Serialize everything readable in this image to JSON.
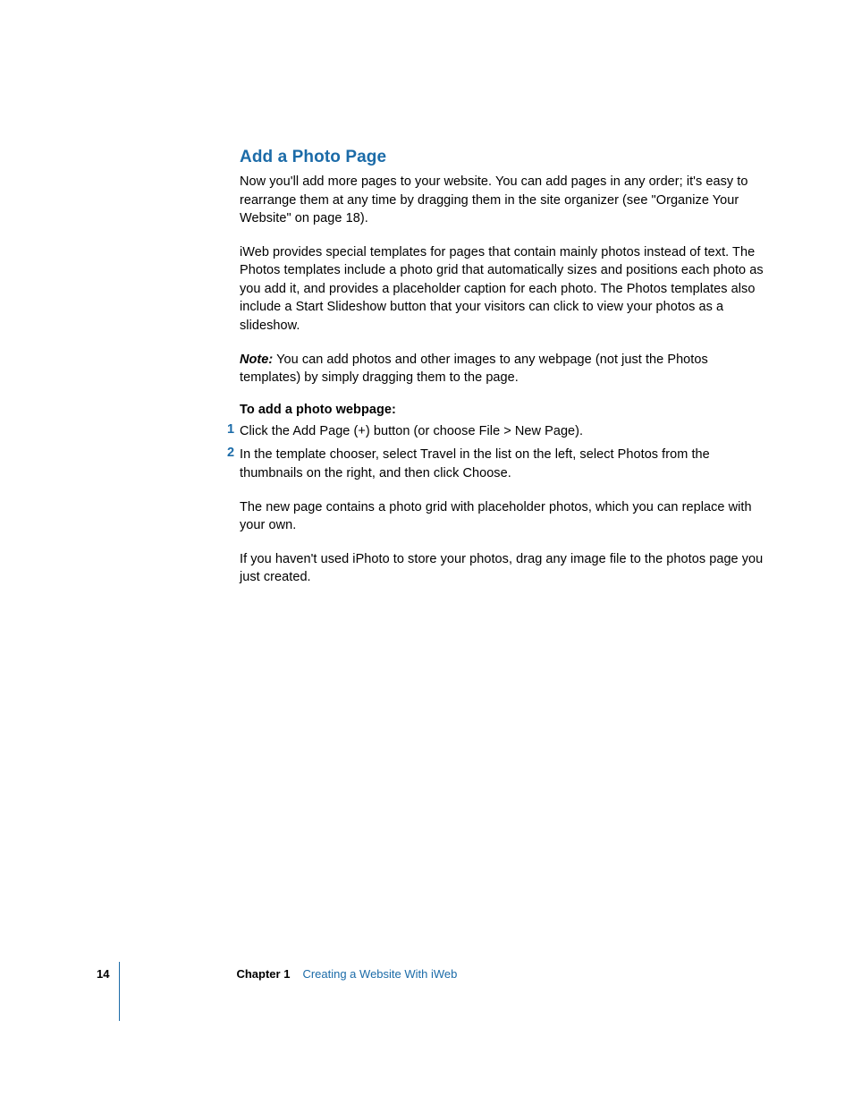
{
  "heading": "Add a Photo Page",
  "para1": "Now you'll add more pages to your website. You can add pages in any order; it's easy to rearrange them at any time by dragging them in the site organizer (see \"Organize Your Website\" on page 18).",
  "para2": "iWeb provides special templates for pages that contain mainly photos instead of text. The Photos templates include a photo grid that automatically sizes and positions each photo as you add it, and provides a placeholder caption for each photo. The Photos templates also include a Start Slideshow button that your visitors can click to view your photos as a slideshow.",
  "noteLabel": "Note:",
  "noteText": "  You can add photos and other images to any webpage (not just the Photos templates) by simply dragging them to the page.",
  "subheading": "To add a photo webpage:",
  "step1Number": "1",
  "step1Text": "Click the Add Page (+) button (or choose File > New Page).",
  "step2Number": "2",
  "step2Text": "In the template chooser, select Travel in the list on the left, select Photos from the thumbnails on the right, and then click Choose.",
  "para3": "The new page contains a photo grid with placeholder photos, which you can replace with your own.",
  "para4": "If you haven't used iPhoto to store your photos, drag any image file to the photos page you just created.",
  "footer": {
    "pageNumber": "14",
    "chapterLabel": "Chapter 1",
    "chapterTitle": "Creating a Website With iWeb"
  }
}
